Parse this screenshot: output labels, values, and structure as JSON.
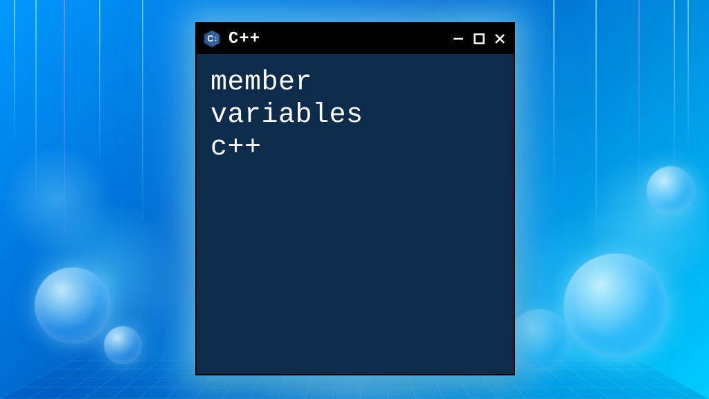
{
  "window": {
    "title": "C++",
    "icon_name": "cpp-hexagon-icon",
    "icon_letter": "C",
    "icon_plus": "++",
    "colors": {
      "titlebar_bg": "#000000",
      "content_bg": "#0d2b4a",
      "text": "#ffffff",
      "glow": "#78dcff",
      "icon_fill": "#2f5b93",
      "icon_stroke": "#1a3a66"
    }
  },
  "content": {
    "line1": "member",
    "line2": "variables",
    "line3": "c++"
  },
  "controls": {
    "minimize": "minimize",
    "maximize": "maximize",
    "close": "close"
  }
}
